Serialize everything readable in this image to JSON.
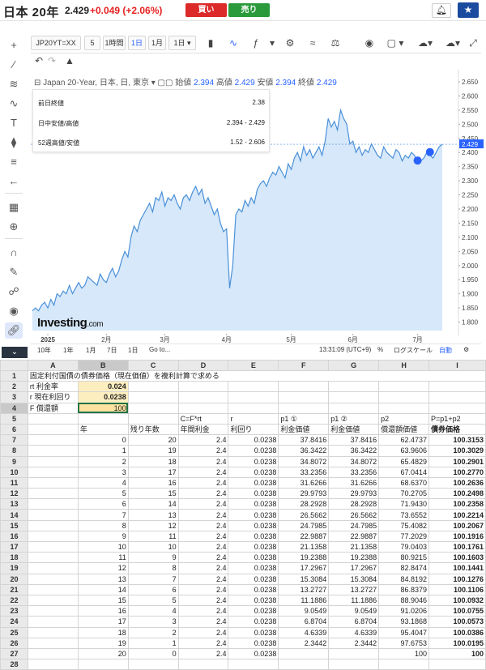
{
  "topbar": {
    "title": "日本 20年",
    "price": "2.429",
    "change": "+0.049 (+2.06%)",
    "buy_label": "買い",
    "sell_label": "売り"
  },
  "chart_toolbar": {
    "symbol": "JP20YT=XX",
    "intervals": [
      "5",
      "1時間",
      "1日",
      "1月",
      "1日"
    ],
    "active_interval": "1日"
  },
  "legend": {
    "name": "Japan 20-Year, 日本, 日, 東京",
    "open_label": "始値",
    "open": "2.394",
    "high_label": "高値",
    "high": "2.429",
    "low_label": "安値",
    "low": "2.394",
    "close_label": "終値",
    "close": "2.429"
  },
  "info_box": [
    {
      "label": "前日終値",
      "value": "2.38"
    },
    {
      "label": "日中安値/高値",
      "value": "2.394 - 2.429"
    },
    {
      "label": "52週高値/安値",
      "value": "1.52 - 2.606"
    }
  ],
  "logo": {
    "brand": "Investing",
    "suffix": ".com"
  },
  "bottom_bar": {
    "ranges": [
      "10年",
      "1年",
      "1月",
      "7日",
      "1日",
      "Go to..."
    ],
    "time": "13:31:09 (UTC+9)",
    "pct": "%",
    "log": "ログスケール",
    "auto": "自動"
  },
  "chart_data": {
    "type": "area",
    "ylim": [
      1.77,
      2.67
    ],
    "y_ticks": [
      2.65,
      2.6,
      2.55,
      2.5,
      2.45,
      2.4,
      2.35,
      2.3,
      2.25,
      2.2,
      2.15,
      2.1,
      2.05,
      2.0,
      1.95,
      1.9,
      1.85,
      1.8
    ],
    "y_tick_labels": [
      "2.650",
      "2.600",
      "2.550",
      "2.500",
      "2.450",
      "2.400",
      "2.350",
      "2.300",
      "2.250",
      "2.200",
      "2.150",
      "2.100",
      "2.050",
      "2.000",
      "1.950",
      "1.900",
      "1.850",
      "1.800"
    ],
    "current_value_label": "2.429",
    "x_tick_labels": [
      "2025",
      "2月",
      "3月",
      "4月",
      "5月",
      "6月",
      "7月"
    ],
    "x_tick_index": [
      5,
      24,
      43,
      63,
      84,
      104,
      125
    ],
    "values": [
      1.84,
      1.85,
      1.84,
      1.86,
      1.87,
      1.85,
      1.88,
      1.86,
      1.9,
      1.89,
      1.91,
      1.9,
      1.93,
      1.9,
      1.92,
      1.94,
      1.92,
      1.93,
      1.96,
      1.95,
      1.94,
      1.93,
      1.97,
      1.95,
      1.94,
      1.97,
      1.99,
      1.96,
      1.98,
      2.02,
      2.05,
      2.03,
      2.1,
      2.14,
      2.12,
      2.16,
      2.18,
      2.2,
      2.22,
      2.19,
      2.24,
      2.23,
      2.26,
      2.21,
      2.24,
      2.23,
      2.25,
      2.22,
      2.2,
      2.24,
      2.25,
      2.23,
      2.26,
      2.28,
      2.25,
      2.27,
      2.22,
      2.24,
      2.21,
      2.18,
      2.2,
      2.15,
      2.12,
      2.13,
      1.92,
      2.0,
      2.18,
      2.2,
      2.19,
      2.23,
      2.21,
      2.24,
      2.22,
      2.27,
      2.29,
      2.3,
      2.28,
      2.31,
      2.33,
      2.32,
      2.35,
      2.33,
      2.31,
      2.36,
      2.34,
      2.38,
      2.4,
      2.37,
      2.42,
      2.39,
      2.41,
      2.38,
      2.4,
      2.42,
      2.39,
      2.44,
      2.52,
      2.49,
      2.51,
      2.48,
      2.55,
      2.52,
      2.5,
      2.43,
      2.44,
      2.4,
      2.42,
      2.39,
      2.41,
      2.4,
      2.43,
      2.41,
      2.39,
      2.38,
      2.42,
      2.4,
      2.39,
      2.38,
      2.41,
      2.4,
      2.37,
      2.39,
      2.38,
      2.4,
      2.39,
      2.36,
      2.37,
      2.38,
      2.4,
      2.39,
      2.38,
      2.4,
      2.42,
      2.429
    ]
  },
  "sheet": {
    "col_headers": [
      "A",
      "B",
      "C",
      "D",
      "E",
      "F",
      "G",
      "H",
      "I"
    ],
    "r1": "固定利付国債の債券価格（現在価値）を複利計算で求める",
    "params": [
      {
        "label": "rt 利金率",
        "value": "0.024"
      },
      {
        "label": "r 現在利回り",
        "value": "0.0238"
      },
      {
        "label": "F 償還額",
        "value": "100"
      }
    ],
    "r5": [
      "",
      "",
      "",
      "C=F*rt",
      "r",
      "p1 ①",
      "p1 ②",
      "p2",
      "P=p1+p2"
    ],
    "r6": [
      "",
      "年",
      "残り年数",
      "年間利金",
      "利回り",
      "利金価値",
      "利金価値",
      "償還額価値",
      "債券価格"
    ],
    "rows": [
      [
        "0",
        "20",
        "2.4",
        "0.0238",
        "37.8416",
        "37.8416",
        "62.4737",
        "100.3153"
      ],
      [
        "1",
        "19",
        "2.4",
        "0.0238",
        "36.3422",
        "36.3422",
        "63.9606",
        "100.3029"
      ],
      [
        "2",
        "18",
        "2.4",
        "0.0238",
        "34.8072",
        "34.8072",
        "65.4829",
        "100.2901"
      ],
      [
        "3",
        "17",
        "2.4",
        "0.0238",
        "33.2356",
        "33.2356",
        "67.0414",
        "100.2770"
      ],
      [
        "4",
        "16",
        "2.4",
        "0.0238",
        "31.6266",
        "31.6266",
        "68.6370",
        "100.2636"
      ],
      [
        "5",
        "15",
        "2.4",
        "0.0238",
        "29.9793",
        "29.9793",
        "70.2705",
        "100.2498"
      ],
      [
        "6",
        "14",
        "2.4",
        "0.0238",
        "28.2928",
        "28.2928",
        "71.9430",
        "100.2358"
      ],
      [
        "7",
        "13",
        "2.4",
        "0.0238",
        "26.5662",
        "26.5662",
        "73.6552",
        "100.2214"
      ],
      [
        "8",
        "12",
        "2.4",
        "0.0238",
        "24.7985",
        "24.7985",
        "75.4082",
        "100.2067"
      ],
      [
        "9",
        "11",
        "2.4",
        "0.0238",
        "22.9887",
        "22.9887",
        "77.2029",
        "100.1916"
      ],
      [
        "10",
        "10",
        "2.4",
        "0.0238",
        "21.1358",
        "21.1358",
        "79.0403",
        "100.1761"
      ],
      [
        "11",
        "9",
        "2.4",
        "0.0238",
        "19.2388",
        "19.2388",
        "80.9215",
        "100.1603"
      ],
      [
        "12",
        "8",
        "2.4",
        "0.0238",
        "17.2967",
        "17.2967",
        "82.8474",
        "100.1441"
      ],
      [
        "13",
        "7",
        "2.4",
        "0.0238",
        "15.3084",
        "15.3084",
        "84.8192",
        "100.1276"
      ],
      [
        "14",
        "6",
        "2.4",
        "0.0238",
        "13.2727",
        "13.2727",
        "86.8379",
        "100.1106"
      ],
      [
        "15",
        "5",
        "2.4",
        "0.0238",
        "11.1886",
        "11.1886",
        "88.9046",
        "100.0932"
      ],
      [
        "16",
        "4",
        "2.4",
        "0.0238",
        "9.0549",
        "9.0549",
        "91.0206",
        "100.0755"
      ],
      [
        "17",
        "3",
        "2.4",
        "0.0238",
        "6.8704",
        "6.8704",
        "93.1868",
        "100.0573"
      ],
      [
        "18",
        "2",
        "2.4",
        "0.0238",
        "4.6339",
        "4.6339",
        "95.4047",
        "100.0386"
      ],
      [
        "19",
        "1",
        "2.4",
        "0.0238",
        "2.3442",
        "2.3442",
        "97.6753",
        "100.0195"
      ],
      [
        "20",
        "0",
        "2.4",
        "0.0238",
        "",
        "",
        "100",
        "100"
      ]
    ]
  }
}
